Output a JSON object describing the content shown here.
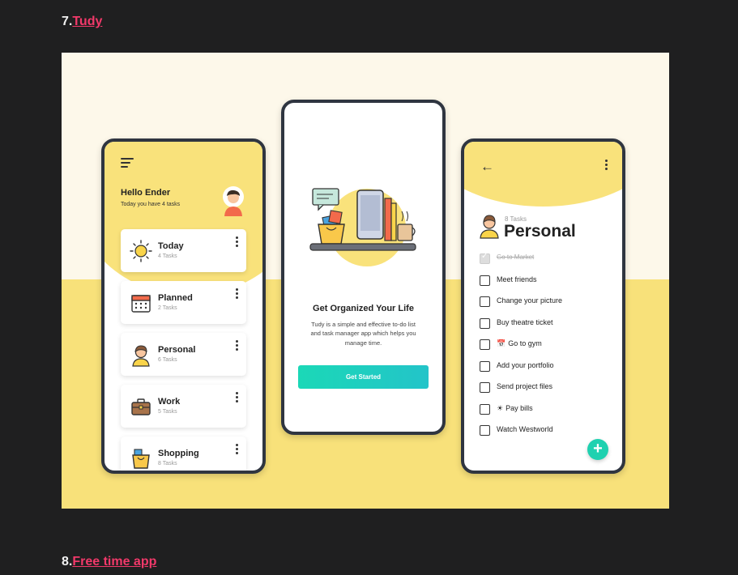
{
  "article": {
    "items": [
      {
        "number": "7.",
        "link_text": "Tudy"
      },
      {
        "number": "8.",
        "link_text": "Free time app"
      }
    ]
  },
  "colors": {
    "page_background": "#1f1f20",
    "link": "#f2396a",
    "accent_yellow": "#f9e27b",
    "accent_teal": "#1fd1b0"
  },
  "phone1": {
    "greeting": "Hello Ender",
    "subtitle": "Today you have 4 tasks",
    "cards": [
      {
        "title": "Today",
        "count": "4 Tasks",
        "icon": "sun-icon"
      },
      {
        "title": "Planned",
        "count": "2 Tasks",
        "icon": "calendar-icon"
      },
      {
        "title": "Personal",
        "count": "6 Tasks",
        "icon": "person-icon"
      },
      {
        "title": "Work",
        "count": "5 Tasks",
        "icon": "briefcase-icon"
      },
      {
        "title": "Shopping",
        "count": "8 Tasks",
        "icon": "shopping-bag-icon"
      }
    ]
  },
  "phone2": {
    "title": "Get Organized Your Life",
    "description": "Tudy is a simple and effective to-do list and task manager app which helps you manage time.",
    "button": "Get Started"
  },
  "phone3": {
    "count": "8 Tasks",
    "title": "Personal",
    "tasks": [
      {
        "label": "Go to Market",
        "done": true
      },
      {
        "label": "Meet friends",
        "done": false
      },
      {
        "label": "Change your picture",
        "done": false
      },
      {
        "label": "Buy theatre ticket",
        "done": false
      },
      {
        "label": "Go to gym",
        "done": false,
        "icon": "calendar-icon"
      },
      {
        "label": "Add your portfolio",
        "done": false
      },
      {
        "label": "Send project files",
        "done": false
      },
      {
        "label": "Pay bills",
        "done": false,
        "icon": "sun-icon"
      },
      {
        "label": "Watch Westworld",
        "done": false
      }
    ],
    "fab": "+"
  }
}
